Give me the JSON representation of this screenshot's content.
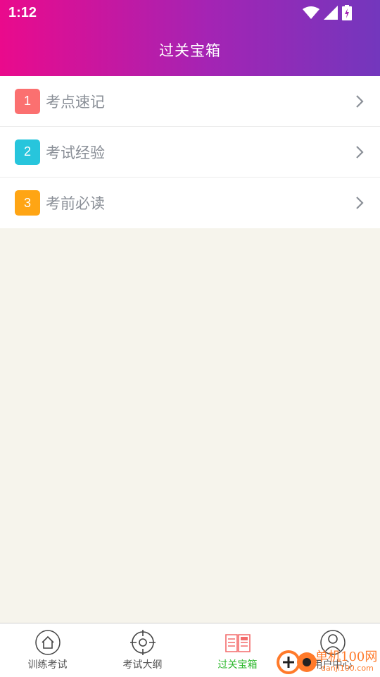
{
  "status_bar": {
    "time": "1:12"
  },
  "header": {
    "title": "过关宝箱"
  },
  "list": {
    "items": [
      {
        "number": "1",
        "label": "考点速记",
        "color": "#fb7070"
      },
      {
        "number": "2",
        "label": "考试经验",
        "color": "#27c5dc"
      },
      {
        "number": "3",
        "label": "考前必读",
        "color": "#ffa514"
      }
    ]
  },
  "tabbar": {
    "tabs": [
      {
        "label": "训练考试",
        "icon": "home-icon"
      },
      {
        "label": "考试大纲",
        "icon": "crosshair-icon"
      },
      {
        "label": "过关宝箱",
        "icon": "book-icon",
        "active": true
      },
      {
        "label": "用户中心",
        "icon": "user-icon"
      }
    ]
  },
  "watermark": {
    "text": "单机100网",
    "url": "danji100.com"
  },
  "colors": {
    "accent_active": "#2db82d",
    "header_start": "#ea0a8c",
    "header_end": "#7337bd"
  }
}
